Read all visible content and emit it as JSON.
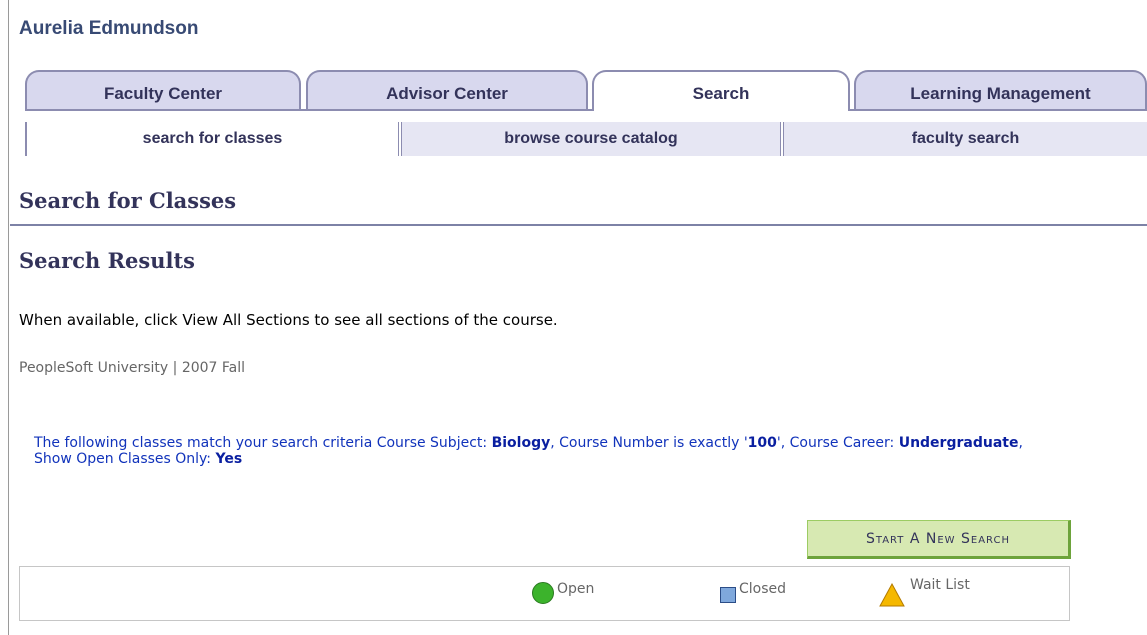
{
  "person": {
    "name": "Aurelia Edmundson"
  },
  "tabs": [
    {
      "label": "Faculty Center",
      "active": false
    },
    {
      "label": "Advisor Center",
      "active": false
    },
    {
      "label": "Search",
      "active": true
    },
    {
      "label": "Learning Management",
      "active": false
    }
  ],
  "subtabs": [
    {
      "label": "search for classes",
      "active": true
    },
    {
      "label": "browse course catalog",
      "active": false
    },
    {
      "label": "faculty search",
      "active": false
    }
  ],
  "page": {
    "heading": "Search for Classes",
    "results_heading": "Search Results",
    "instruction": "When available, click View All Sections to see all sections of the course.",
    "institution_term": "PeopleSoft University | 2007 Fall"
  },
  "criteria": {
    "prefix": "The following classes match your search criteria Course Subject: ",
    "subject": "Biology",
    "number_label": ",  Course Number is exactly '",
    "number": "100",
    "career_label": "',  Course Career: ",
    "career": "Undergraduate",
    "open_label": ",  Show Open Classes Only: ",
    "open_only": "Yes"
  },
  "buttons": {
    "new_search": "Start A New Search"
  },
  "legend": {
    "open": "Open",
    "closed": "Closed",
    "wait_list": "Wait List"
  },
  "colors": {
    "accent": "#33335a",
    "open": "#3cb32c",
    "closed": "#7fa8dc",
    "wait_list": "#f5b800",
    "button_bg": "#d7e9b2"
  }
}
